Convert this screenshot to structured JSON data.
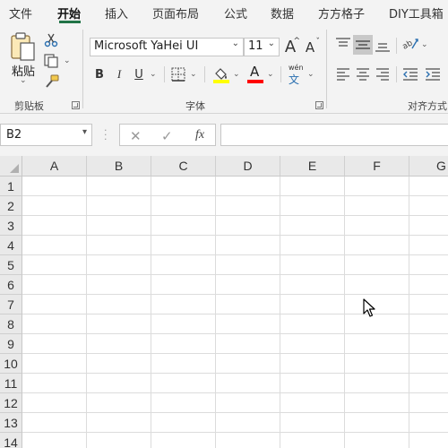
{
  "menu": {
    "tabs": [
      {
        "label": "文件"
      },
      {
        "label": "开始"
      },
      {
        "label": "插入"
      },
      {
        "label": "页面布局"
      },
      {
        "label": "公式"
      },
      {
        "label": "数据"
      },
      {
        "label": "方方格子"
      },
      {
        "label": "DIY工具箱"
      }
    ],
    "active_tab": "开始"
  },
  "ribbon": {
    "clipboard": {
      "paste_label": "粘贴",
      "group_label": "剪贴板"
    },
    "font": {
      "font_name": "Microsoft YaHei UI",
      "font_size": "11",
      "bold": "B",
      "italic": "I",
      "underline": "U",
      "grow_font": "A",
      "shrink_font": "A",
      "font_color_glyph": "A",
      "phonetic_top": "wén",
      "phonetic_bottom": "文",
      "group_label": "字体",
      "fill_color": "#ffff00",
      "font_color": "#ff0000"
    },
    "alignment": {
      "group_label": "对齐方式"
    }
  },
  "formula_bar": {
    "name_box": "B2",
    "cancel_glyph": "✕",
    "enter_glyph": "✓",
    "fx_label": "fx",
    "formula": ""
  },
  "sheet": {
    "columns": [
      "A",
      "B",
      "C",
      "D",
      "E",
      "F",
      "G"
    ],
    "rows": [
      "1",
      "2",
      "3",
      "4",
      "5",
      "6",
      "7",
      "8",
      "9",
      "10",
      "11",
      "12",
      "13",
      "14"
    ]
  }
}
